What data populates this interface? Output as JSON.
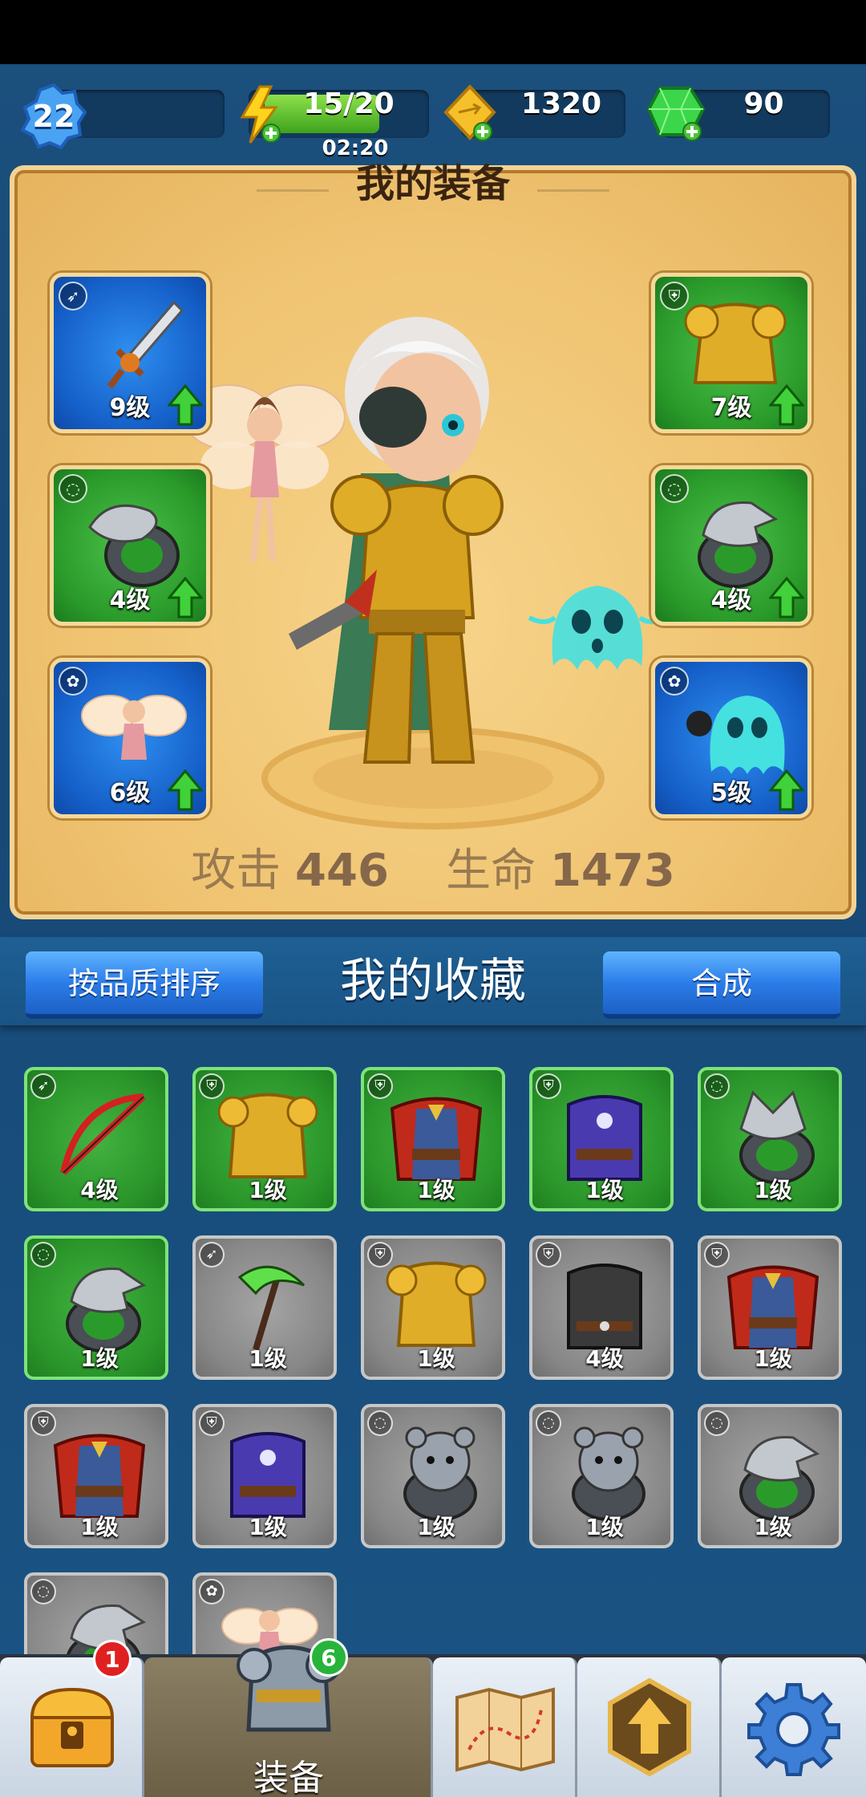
{
  "hud": {
    "player_level": "22",
    "energy": "15/20",
    "energy_timer": "02:20",
    "energy_fill": 0.75,
    "gold": "1320",
    "gems": "90"
  },
  "equipment": {
    "title": "我的装备",
    "slots": [
      {
        "type": "weapon",
        "type_icon": "bow-arrow-icon",
        "level": "9级",
        "item": "sword",
        "color": "blue"
      },
      {
        "type": "armor",
        "type_icon": "armor-icon",
        "level": "7级",
        "item": "gold-armor",
        "color": "green"
      },
      {
        "type": "ring",
        "type_icon": "ring-icon",
        "level": "4级",
        "item": "serpent-ring",
        "color": "green"
      },
      {
        "type": "ring",
        "type_icon": "ring-icon",
        "level": "4级",
        "item": "eagle-ring",
        "color": "green"
      },
      {
        "type": "pet",
        "type_icon": "paw-icon",
        "level": "6级",
        "item": "fairy",
        "color": "blue"
      },
      {
        "type": "pet",
        "type_icon": "paw-icon",
        "level": "5级",
        "item": "ghost",
        "color": "blue"
      }
    ],
    "stats": {
      "attack_label": "攻击",
      "attack_value": "446",
      "hp_label": "生命",
      "hp_value": "1473"
    }
  },
  "collection": {
    "sort_button": "按品质排序",
    "title": "我的收藏",
    "merge_button": "合成",
    "items": [
      {
        "level": "4级",
        "quality": "green",
        "item": "red-bow"
      },
      {
        "level": "1级",
        "quality": "green",
        "item": "gold-armor"
      },
      {
        "level": "1级",
        "quality": "green",
        "item": "red-cape"
      },
      {
        "level": "1级",
        "quality": "green",
        "item": "purple-robe"
      },
      {
        "level": "1级",
        "quality": "green",
        "item": "wolf-ring"
      },
      {
        "level": "1级",
        "quality": "green",
        "item": "eagle-ring"
      },
      {
        "level": "1级",
        "quality": "grey",
        "item": "green-scythe"
      },
      {
        "level": "1级",
        "quality": "grey",
        "item": "gold-armor"
      },
      {
        "level": "4级",
        "quality": "grey",
        "item": "dark-tunic"
      },
      {
        "level": "1级",
        "quality": "grey",
        "item": "red-cape"
      },
      {
        "level": "1级",
        "quality": "grey",
        "item": "red-cape"
      },
      {
        "level": "1级",
        "quality": "grey",
        "item": "purple-robe"
      },
      {
        "level": "1级",
        "quality": "grey",
        "item": "bear-ring"
      },
      {
        "level": "1级",
        "quality": "grey",
        "item": "bear-ring"
      },
      {
        "level": "1级",
        "quality": "grey",
        "item": "eagle-ring"
      },
      {
        "level": "",
        "quality": "grey",
        "item": "eagle-ring"
      },
      {
        "level": "",
        "quality": "grey",
        "item": "fairy"
      }
    ]
  },
  "nav": {
    "chest_badge": "1",
    "equip_label": "装备",
    "equip_badge": "6",
    "items": [
      "chest-icon",
      "armor-icon",
      "map-icon",
      "upgrade-icon",
      "gear-icon"
    ]
  },
  "colors": {
    "panel": "#efc371",
    "slot_blue": "#1560c9",
    "slot_green": "#2a9b2a",
    "grey_cell": "#878787",
    "accent_button": "#2b7de9"
  }
}
